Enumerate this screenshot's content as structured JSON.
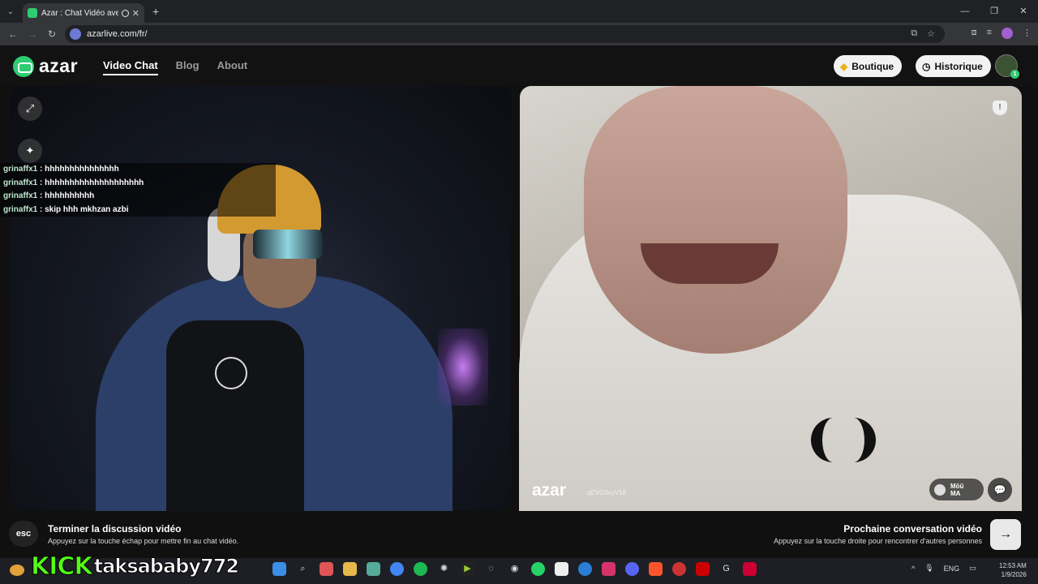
{
  "browser": {
    "tab_title": "Azar : Chat Vidéo avec de n",
    "url": "azarlive.com/fr/"
  },
  "header": {
    "logo_text": "azar",
    "nav": [
      "Video Chat",
      "Blog",
      "About"
    ],
    "boutique_label": "Boutique",
    "historique_label": "Historique",
    "avatar_badge": "1"
  },
  "chat": {
    "messages": [
      {
        "user": "grinaffx1",
        "text": ": hhhhhhhhhhhhhhh"
      },
      {
        "user": "grinaffx1",
        "text": ": hhhhhhhhhhhhhhhhhhhh"
      },
      {
        "user": "grinaffx1",
        "text": ": hhhhhhhhhh"
      },
      {
        "user": "grinaffx1",
        "text": ": skip hhh mkhzan azbi"
      }
    ]
  },
  "remote": {
    "watermark": "azar",
    "watermark_id": "qEVO3vyV18",
    "user_name": "Mōū",
    "user_country": "MA"
  },
  "bottom": {
    "esc_label": "esc",
    "end_title": "Terminer la discussion vidéo",
    "end_sub": "Appuyez sur la touche échap pour mettre fin au chat vidéo.",
    "next_title": "Prochaine conversation vidéo",
    "next_sub": "Appuyez sur la touche droite pour rencontrer d'autres personnes"
  },
  "overlay": {
    "kick_logo": "KICK",
    "kick_user": "taksababy772"
  },
  "taskbar": {
    "lang": "ENG",
    "time": "12:53 AM",
    "date": "1/9/2026"
  },
  "colors": {
    "brand_green": "#2ecc71",
    "kick_green": "#53fc18"
  }
}
